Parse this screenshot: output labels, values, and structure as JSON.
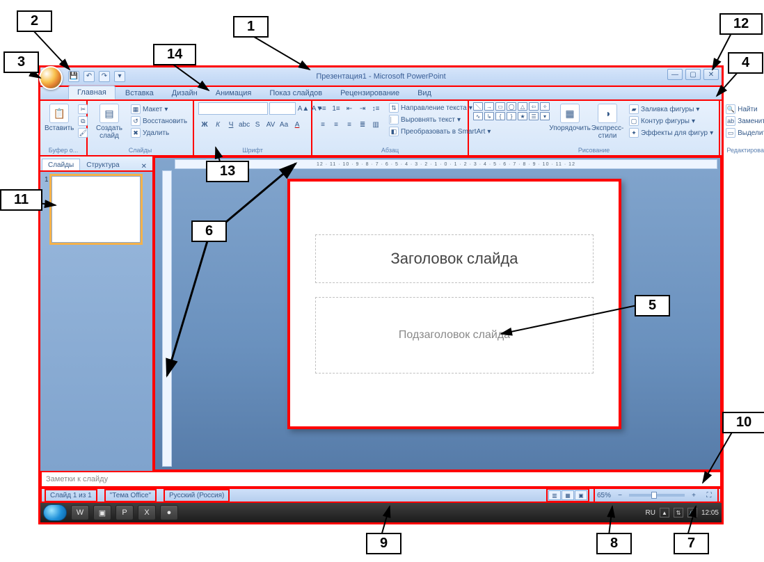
{
  "callouts": {
    "c1": "1",
    "c2": "2",
    "c3": "3",
    "c4": "4",
    "c5": "5",
    "c6": "6",
    "c7": "7",
    "c8": "8",
    "c9": "9",
    "c10": "10",
    "c11": "11",
    "c12": "12",
    "c13": "13",
    "c14": "14"
  },
  "titlebar": {
    "title": "Презентация1 - Microsoft PowerPoint"
  },
  "tabs": {
    "home": "Главная",
    "insert": "Вставка",
    "design": "Дизайн",
    "animation": "Анимация",
    "slideshow": "Показ слайдов",
    "review": "Рецензирование",
    "view": "Вид"
  },
  "ribbon": {
    "clipboard": {
      "label": "Буфер о...",
      "paste": "Вставить"
    },
    "slides": {
      "label": "Слайды",
      "new": "Создать\nслайд",
      "layout": "Макет",
      "reset": "Восстановить",
      "delete": "Удалить"
    },
    "font": {
      "label": "Шрифт"
    },
    "paragraph": {
      "label": "Абзац",
      "textdir": "Направление текста",
      "align": "Выровнять текст",
      "convert": "Преобразовать в SmartArt"
    },
    "drawing": {
      "label": "Рисование",
      "arrange": "Упорядочить",
      "quick": "Экспресс-стили",
      "fill": "Заливка фигуры",
      "outline": "Контур фигуры",
      "effects": "Эффекты для фигур"
    },
    "editing": {
      "label": "Редактирование",
      "find": "Найти",
      "replace": "Заменить",
      "select": "Выделить"
    }
  },
  "leftpanel": {
    "slides_tab": "Слайды",
    "outline_tab": "Структура",
    "thumb_number": "1"
  },
  "ruler_text": "12 · 11 · 10 · 9 · 8 · 7 · 6 · 5 · 4 · 3 · 2 · 1 · 0 · 1 · 2 · 3 · 4 · 5 · 6 · 7 · 8 · 9 · 10 · 11 · 12",
  "slide": {
    "title_placeholder": "Заголовок слайда",
    "subtitle_placeholder": "Подзаголовок слайда"
  },
  "notes": {
    "placeholder": "Заметки к слайду"
  },
  "status": {
    "slide_of": "Слайд 1 из 1",
    "theme": "\"Тема Office\"",
    "lang": "Русский (Россия)",
    "zoom": "65%"
  },
  "tray": {
    "lang": "RU",
    "time": "12:05"
  }
}
